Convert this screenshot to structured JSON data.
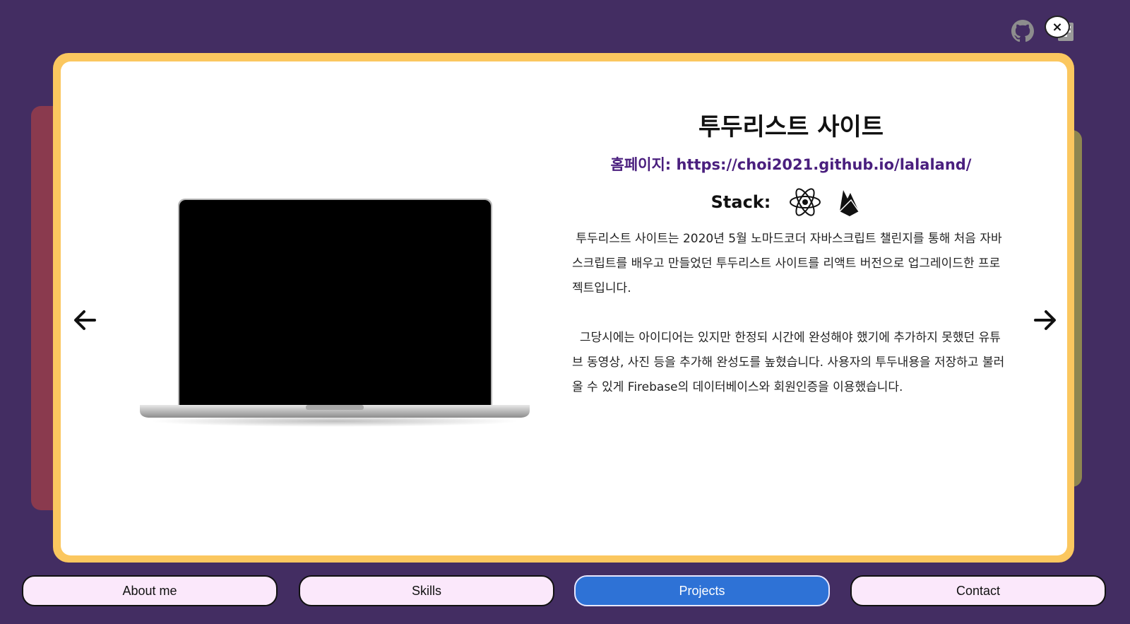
{
  "project": {
    "title": "투두리스트 사이트",
    "homepage_label": "홈페이지:",
    "homepage_url": "https://choi2021.github.io/lalaland/",
    "stack_label": "Stack:",
    "stack_icons": [
      "react-icon",
      "firebase-icon"
    ],
    "description": " 투두리스트 사이트는 2020년 5월 노마드코더 자바스크립트 챌린지를 통해 처음 자바스크립트를 배우고 만들었던 투두리스트 사이트를 리액트 버전으로 업그레이드한 프로젝트입니다.\n\n  그당시에는 아이디어는 있지만 한정되 시간에 완성해야 했기에 추가하지 못했던 유튜브 동영상, 사진 등을 추가해 완성도를 높혔습니다. 사용자의 투두내용을 저장하고 불러올 수 있게 Firebase의 데이터베이스와 회원인증을 이용했습니다."
  },
  "controls": {
    "close_label": "×",
    "prev_icon": "arrow-left-icon",
    "next_icon": "arrow-right-icon"
  },
  "top_icons": [
    "github-icon",
    "blog-icon"
  ],
  "nav": {
    "items": [
      {
        "label": "About me",
        "active": false
      },
      {
        "label": "Skills",
        "active": false
      },
      {
        "label": "Projects",
        "active": true
      },
      {
        "label": "Contact",
        "active": false
      }
    ]
  },
  "colors": {
    "background": "#432d62",
    "frame": "#fbc75f",
    "nav_active": "#2e72d6",
    "nav_inactive": "#fbe8fb",
    "link": "#4a1f7e"
  }
}
